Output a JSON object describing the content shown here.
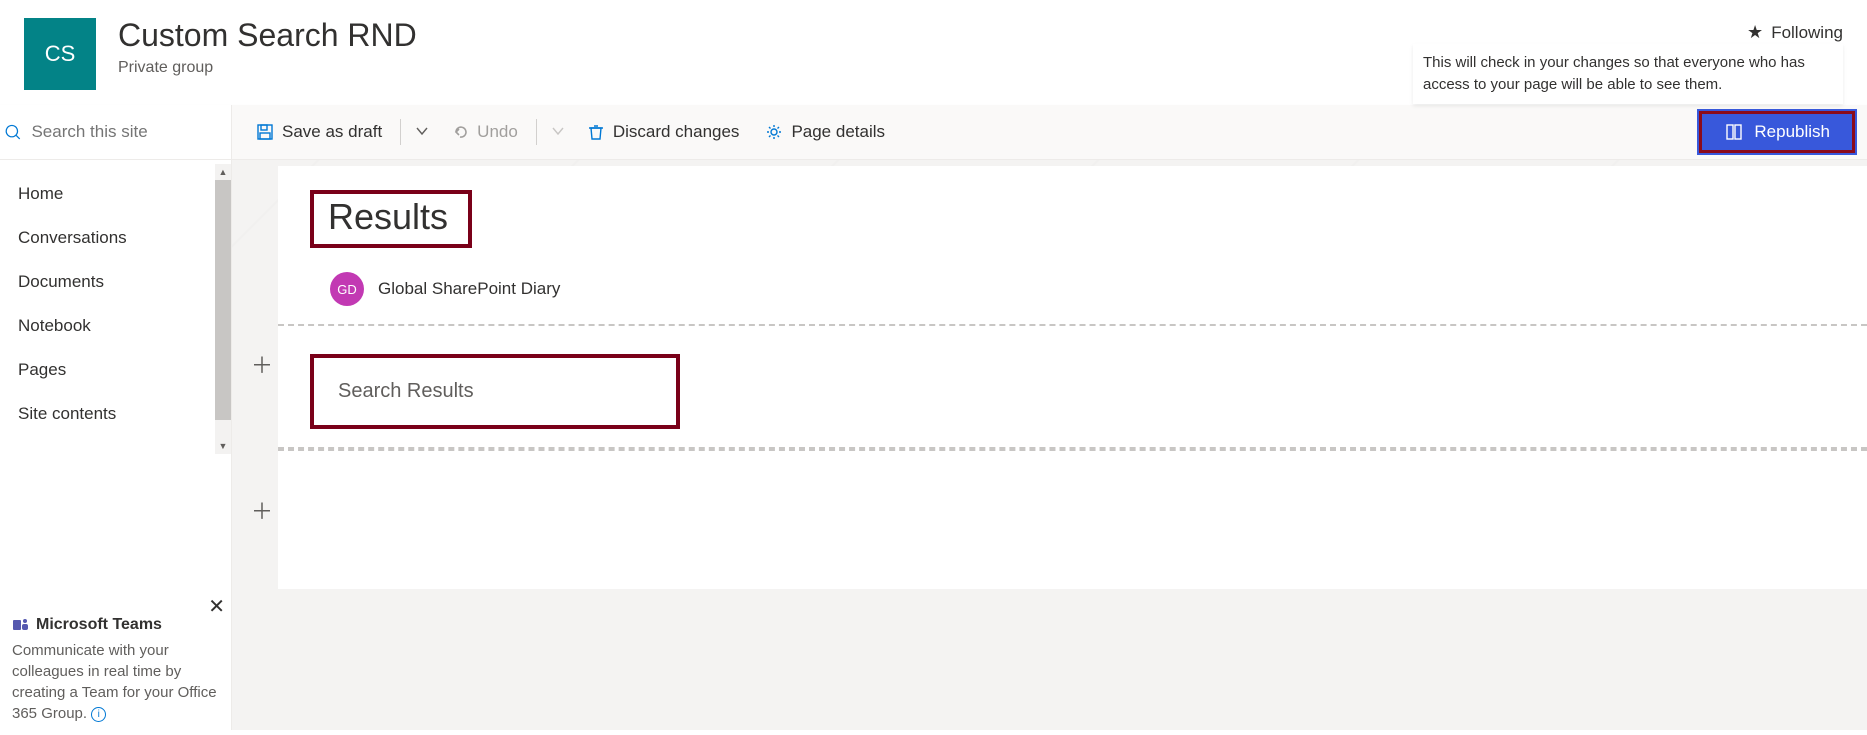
{
  "header": {
    "logo_initials": "CS",
    "title": "Custom Search RND",
    "subtitle": "Private group",
    "following_label": "Following",
    "tooltip": "This will check in your changes so that everyone who has access to your page will be able to see them."
  },
  "search": {
    "placeholder": "Search this site"
  },
  "nav": {
    "items": [
      "Home",
      "Conversations",
      "Documents",
      "Notebook",
      "Pages",
      "Site contents"
    ]
  },
  "teams": {
    "title": "Microsoft Teams",
    "body_prefix": "Communicate with your colleagues in real time by creating a Team for your Office 365 Group.",
    "info_glyph": "i"
  },
  "cmdbar": {
    "save": "Save as draft",
    "undo": "Undo",
    "discard": "Discard changes",
    "pagedetails": "Page details",
    "republish": "Republish"
  },
  "page": {
    "results_title": "Results",
    "author_initials": "GD",
    "author_name": "Global SharePoint Diary",
    "search_results_label": "Search Results"
  }
}
